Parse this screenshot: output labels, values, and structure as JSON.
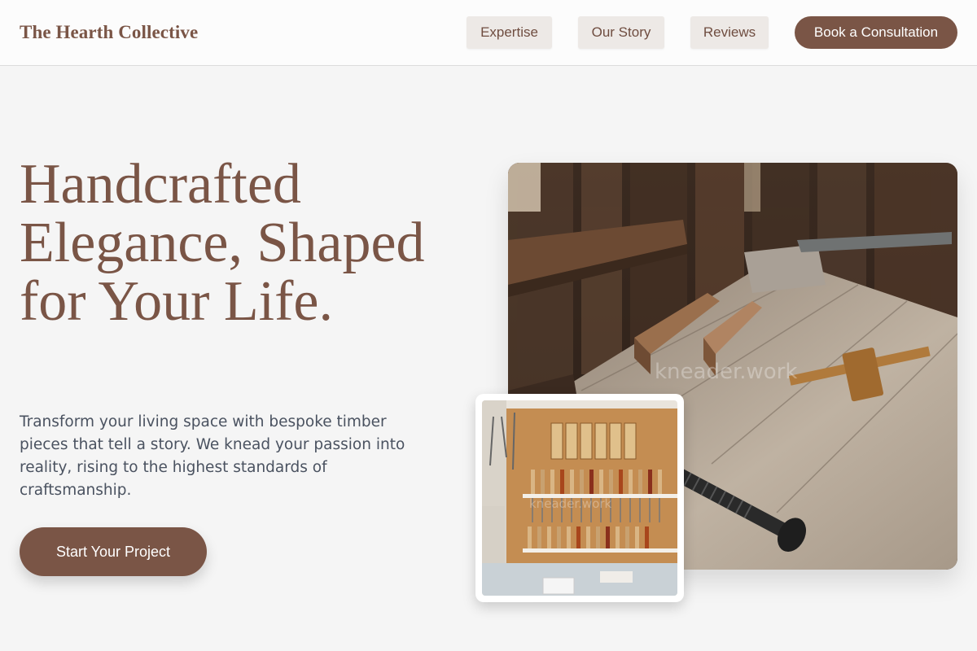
{
  "header": {
    "brand": "The Hearth Collective",
    "nav": {
      "expertise": "Expertise",
      "story": "Our Story",
      "reviews": "Reviews"
    },
    "cta": "Book a Consultation"
  },
  "hero": {
    "title": "Handcrafted Elegance, Shaped for Your Life.",
    "subtitle": "Transform your living space with bespoke timber pieces that tell a story. We knead your passion into reality, rising to the highest standards of craftsmanship.",
    "cta": "Start Your Project"
  },
  "images": {
    "main_watermark": "kneader.work",
    "small_watermark": "kneader.work"
  },
  "colors": {
    "brand": "#7a5546",
    "nav_bg": "#ede9e6",
    "page_bg": "#f5f5f5",
    "body_text": "#4a5260"
  }
}
